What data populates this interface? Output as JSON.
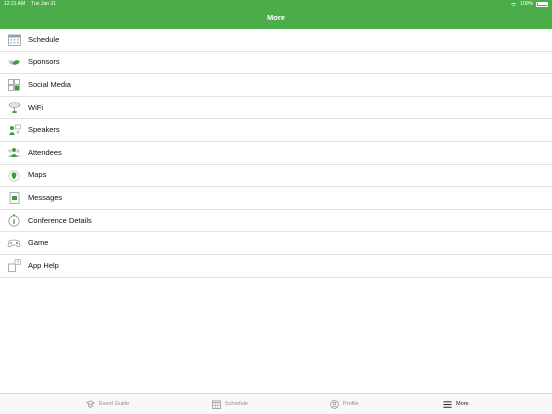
{
  "status_bar": {
    "time": "12:21 AM",
    "date": "Tue Jan 31",
    "battery": "100%"
  },
  "header": {
    "title": "More"
  },
  "menu": [
    {
      "label": "Schedule",
      "icon": "calendar-icon"
    },
    {
      "label": "Sponsors",
      "icon": "handshake-icon"
    },
    {
      "label": "Social Media",
      "icon": "social-grid-icon"
    },
    {
      "label": "WiFi",
      "icon": "wifi-router-icon"
    },
    {
      "label": "Speakers",
      "icon": "speakers-icon"
    },
    {
      "label": "Attendees",
      "icon": "attendees-icon"
    },
    {
      "label": "Maps",
      "icon": "map-pin-icon"
    },
    {
      "label": "Messages",
      "icon": "messages-icon"
    },
    {
      "label": "Conference Details",
      "icon": "info-icon"
    },
    {
      "label": "Game",
      "icon": "gamepad-icon"
    },
    {
      "label": "App Help",
      "icon": "help-icon"
    }
  ],
  "tabbar": {
    "tabs": [
      {
        "label": "Event Guide",
        "icon": "event-guide-icon"
      },
      {
        "label": "Schedule",
        "icon": "calendar-icon"
      },
      {
        "label": "Profile",
        "icon": "profile-icon"
      },
      {
        "label": "More",
        "icon": "hamburger-icon",
        "active": true
      }
    ]
  },
  "colors": {
    "accent": "#4aad4a",
    "icon_green": "#3f9b3f",
    "icon_gray": "#9a9a9a"
  }
}
